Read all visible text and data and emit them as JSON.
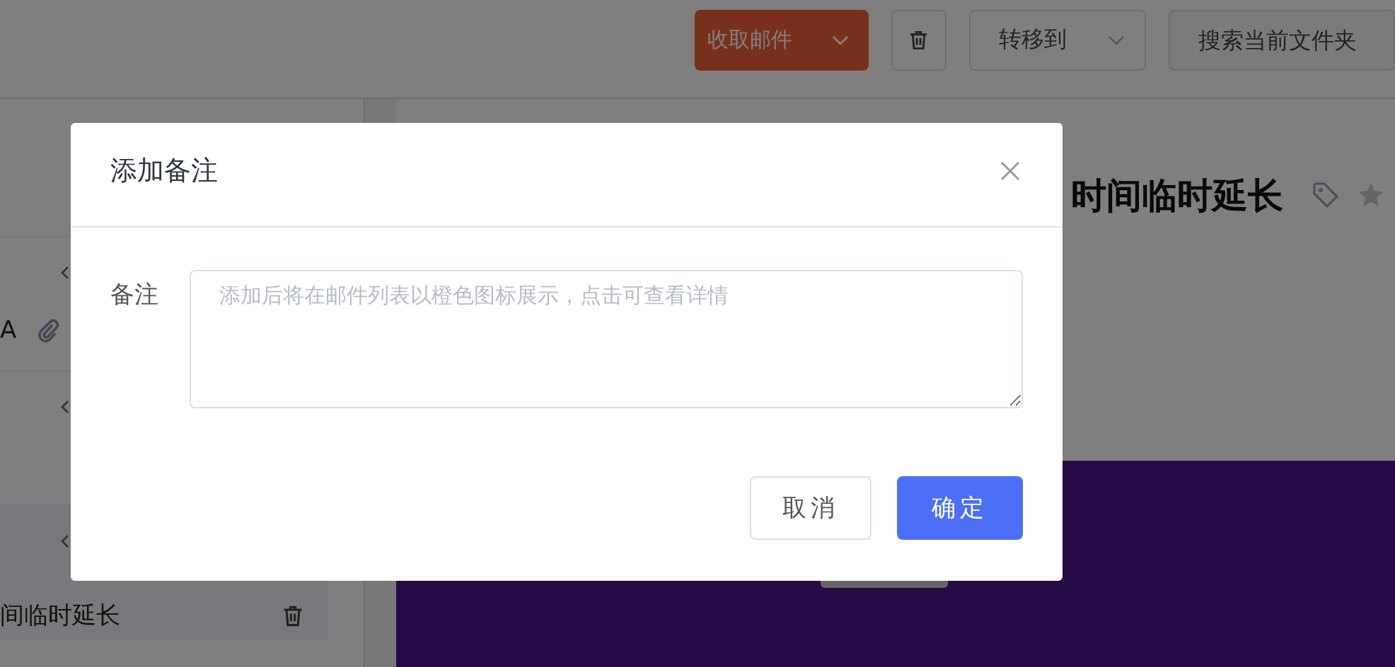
{
  "toolbar": {
    "receive_button": {
      "label": "收取邮件"
    },
    "move_dropdown": {
      "label": "转移到"
    },
    "search": {
      "placeholder": "搜索当前文件夹"
    }
  },
  "mail_list": [
    {
      "subject": "A",
      "attachment": true,
      "selected": false
    },
    {
      "selected": false
    },
    {
      "subject": "间临时延长",
      "selected": true
    }
  ],
  "mail_view": {
    "subject": "时间临时延长",
    "starred": false
  },
  "dialog": {
    "title": "添加备注",
    "field_label": "备注",
    "placeholder": "添加后将在邮件列表以橙色图标展示，点击可查看详情",
    "buttons": [
      {
        "label": "取消",
        "kind": "secondary"
      },
      {
        "label": "确定",
        "kind": "primary"
      }
    ]
  }
}
